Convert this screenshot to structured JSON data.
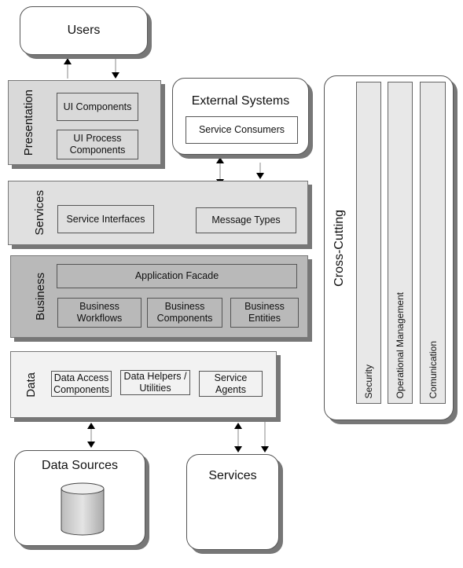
{
  "users": {
    "title": "Users"
  },
  "presentation": {
    "label": "Presentation",
    "items": [
      "UI Components",
      "UI Process Components"
    ]
  },
  "external": {
    "title": "External Systems",
    "items": [
      "Service Consumers"
    ]
  },
  "services_layer": {
    "label": "Services",
    "items": [
      "Service Interfaces",
      "Message Types"
    ]
  },
  "business": {
    "label": "Business",
    "facade": "Application Facade",
    "items": [
      "Business Workflows",
      "Business Components",
      "Business Entities"
    ]
  },
  "data": {
    "label": "Data",
    "items": [
      "Data Access Components",
      "Data Helpers / Utilities",
      "Service Agents"
    ]
  },
  "data_sources": {
    "title": "Data Sources",
    "icon": "database-icon"
  },
  "services_ext": {
    "title": "Services"
  },
  "cross_cutting": {
    "label": "Cross-Cutting",
    "items": [
      "Security",
      "Operational Management",
      "Comunication"
    ]
  },
  "colors": {
    "presentation": "#d9d9d9",
    "services": "#e0e0e0",
    "business": "#b9b9b9",
    "data": "#f2f2f2",
    "shadow": "#777777"
  }
}
